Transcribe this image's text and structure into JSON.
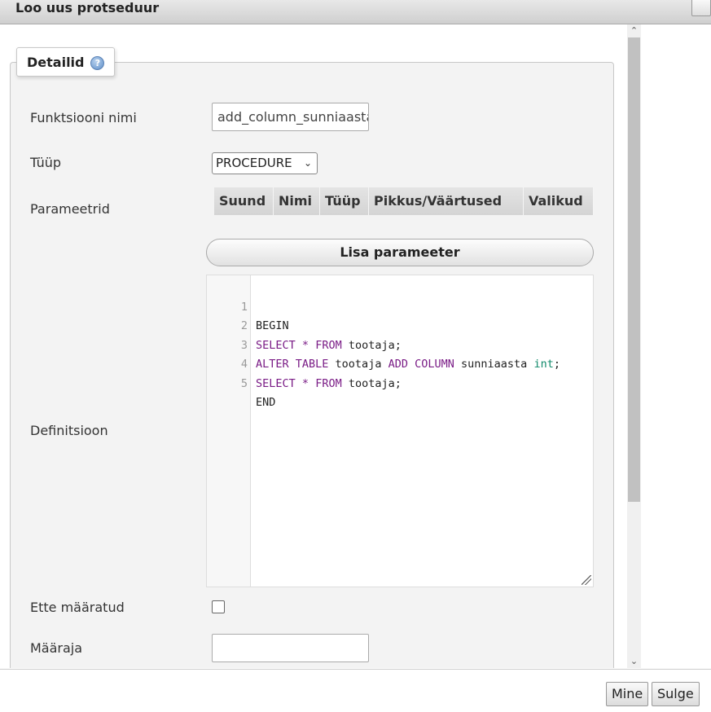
{
  "dialog": {
    "title": "Loo uus protseduur"
  },
  "panel": {
    "legend": "Detailid",
    "help_icon": "?"
  },
  "form": {
    "name_label": "Funktsiooni nimi",
    "name_value": "add_column_sunniaasta",
    "type_label": "Tüüp",
    "type_value": "PROCEDURE",
    "params_label": "Parameetrid",
    "params_columns": [
      "Suund",
      "Nimi",
      "Tüüp",
      "Pikkus/Väärtused",
      "Valikud"
    ],
    "add_param_label": "Lisa parameeter",
    "definition_label": "Definitsioon",
    "deterministic_label": "Ette määratud",
    "definer_label": "Määraja",
    "definer_value": ""
  },
  "editor": {
    "line_numbers": [
      "1",
      "2",
      "3",
      "4",
      "5"
    ],
    "lines": [
      "BEGIN",
      "SELECT * FROM tootaja;",
      "ALTER TABLE tootaja ADD COLUMN sunniaasta int;",
      "SELECT * FROM tootaja;",
      "END"
    ]
  },
  "footer": {
    "go_label": "Mine",
    "close_label": "Sulge"
  }
}
